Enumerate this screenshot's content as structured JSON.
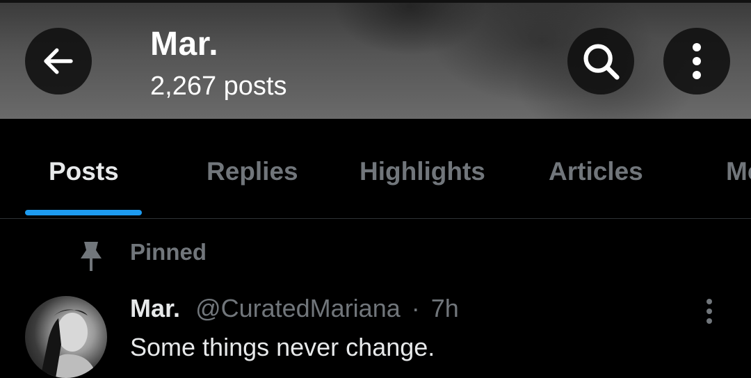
{
  "header": {
    "profile_name": "Mar.",
    "post_count": "2,267 posts",
    "back_icon": "arrow-left-icon",
    "search_icon": "search-icon",
    "more_icon": "more-vertical-icon"
  },
  "tabs": [
    {
      "label": "Posts",
      "active": true
    },
    {
      "label": "Replies",
      "active": false
    },
    {
      "label": "Highlights",
      "active": false
    },
    {
      "label": "Articles",
      "active": false
    },
    {
      "label": "Me",
      "active": false
    }
  ],
  "colors": {
    "accent": "#1d9bf0",
    "background": "#000000",
    "text_primary": "#e7e9ea",
    "text_secondary": "#71767b"
  },
  "pinned": {
    "label": "Pinned",
    "icon": "pin-icon"
  },
  "post": {
    "author": "Mar.",
    "handle": "@CuratedMariana",
    "separator": "·",
    "time": "7h",
    "text": "Some things never change.",
    "more_icon": "more-vertical-icon"
  }
}
